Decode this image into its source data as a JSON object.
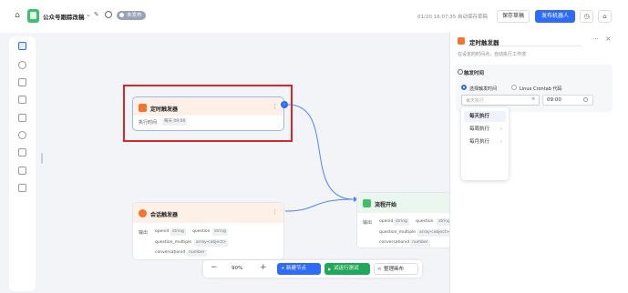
{
  "topbar": {
    "title": "公众号跟踪改稿",
    "badge": "未发布",
    "status": "01/20 16:07:35 自动保存草稿",
    "save_label": "保存草稿",
    "publish_label": "发布机器人"
  },
  "canvas": {
    "zoom": "90%",
    "new_node_label": "新建节点",
    "run_test_label": "试运行测试",
    "tidy_label": "整理画布"
  },
  "nodes": {
    "timer": {
      "title": "定时触发器",
      "exec_label": "执行时间",
      "exec_value": "每天 09:00"
    },
    "chat": {
      "title": "会话触发器",
      "output_label": "输出",
      "fields": [
        {
          "name": "openid",
          "type": "string"
        },
        {
          "name": "question",
          "type": "string"
        },
        {
          "name": "question_multiple",
          "type": "array<object>"
        },
        {
          "name": "conversationid",
          "type": "number"
        }
      ]
    },
    "flow": {
      "title": "流程开始",
      "input_label": "输出",
      "fields": [
        {
          "name": "openid",
          "type": "string"
        },
        {
          "name": "question",
          "type": "string"
        },
        {
          "name": "question_multiple",
          "type": "array<object>"
        },
        {
          "name": "conversationid",
          "type": "number"
        }
      ]
    }
  },
  "panel": {
    "title": "定时触发器",
    "description": "在设定的时间点，自动执行工作流",
    "section_title": "触发时间",
    "radio_select_label": "选择触发时间",
    "radio_cron_label": "Linux Crontab 代码",
    "select_placeholder": "每天执行",
    "time_value": "09:00",
    "dropdown": [
      {
        "label": "每天执行",
        "selected": true
      },
      {
        "label": "每周执行",
        "selected": false
      },
      {
        "label": "每月执行",
        "selected": false
      }
    ]
  },
  "colors": {
    "accent": "#2f6cf6",
    "run": "#22a85a",
    "timer_icon": "#f4732e",
    "flow_icon": "#3fbf6a",
    "highlight": "#d9262a"
  }
}
